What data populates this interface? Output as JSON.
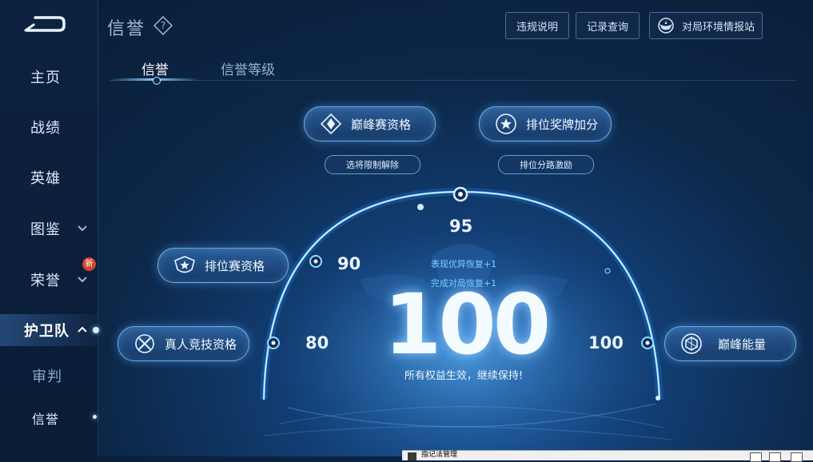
{
  "page": {
    "title": "信誉"
  },
  "sidebar": {
    "items": [
      {
        "label": "主页"
      },
      {
        "label": "战绩"
      },
      {
        "label": "英雄"
      },
      {
        "label": "图鉴"
      },
      {
        "label": "荣誉",
        "badge": "新"
      },
      {
        "label": "护卫队"
      },
      {
        "label": "审判"
      },
      {
        "label": "信誉"
      }
    ]
  },
  "header": {
    "buttons": {
      "violation": "违规说明",
      "records": "记录查询",
      "environment": "对局环境情报站"
    }
  },
  "tabs": [
    {
      "label": "信誉",
      "active": true
    },
    {
      "label": "信誉等级",
      "active": false
    }
  ],
  "privileges": {
    "peak_qualification": "巅峰赛资格",
    "ranked_medal_bonus": "排位奖牌加分",
    "hero_restriction": "选将限制解除",
    "lane_incentive": "排位分路激励",
    "ranked_qualification": "排位赛资格",
    "real_player_qualification": "真人竞技资格",
    "peak_energy": "巅峰能量"
  },
  "gauge": {
    "thresholds": [
      "80",
      "90",
      "95",
      "100"
    ],
    "score": "100",
    "bonus_lines": [
      "表现优异恢复+1",
      "完成对局恢复+1"
    ],
    "caption": "所有权益生效，继续保持!"
  },
  "bottom_window": {
    "title": "指记法管理"
  },
  "colors": {
    "accent": "#7fd0ff",
    "badge": "#d2452f",
    "background": "#0c2748"
  }
}
